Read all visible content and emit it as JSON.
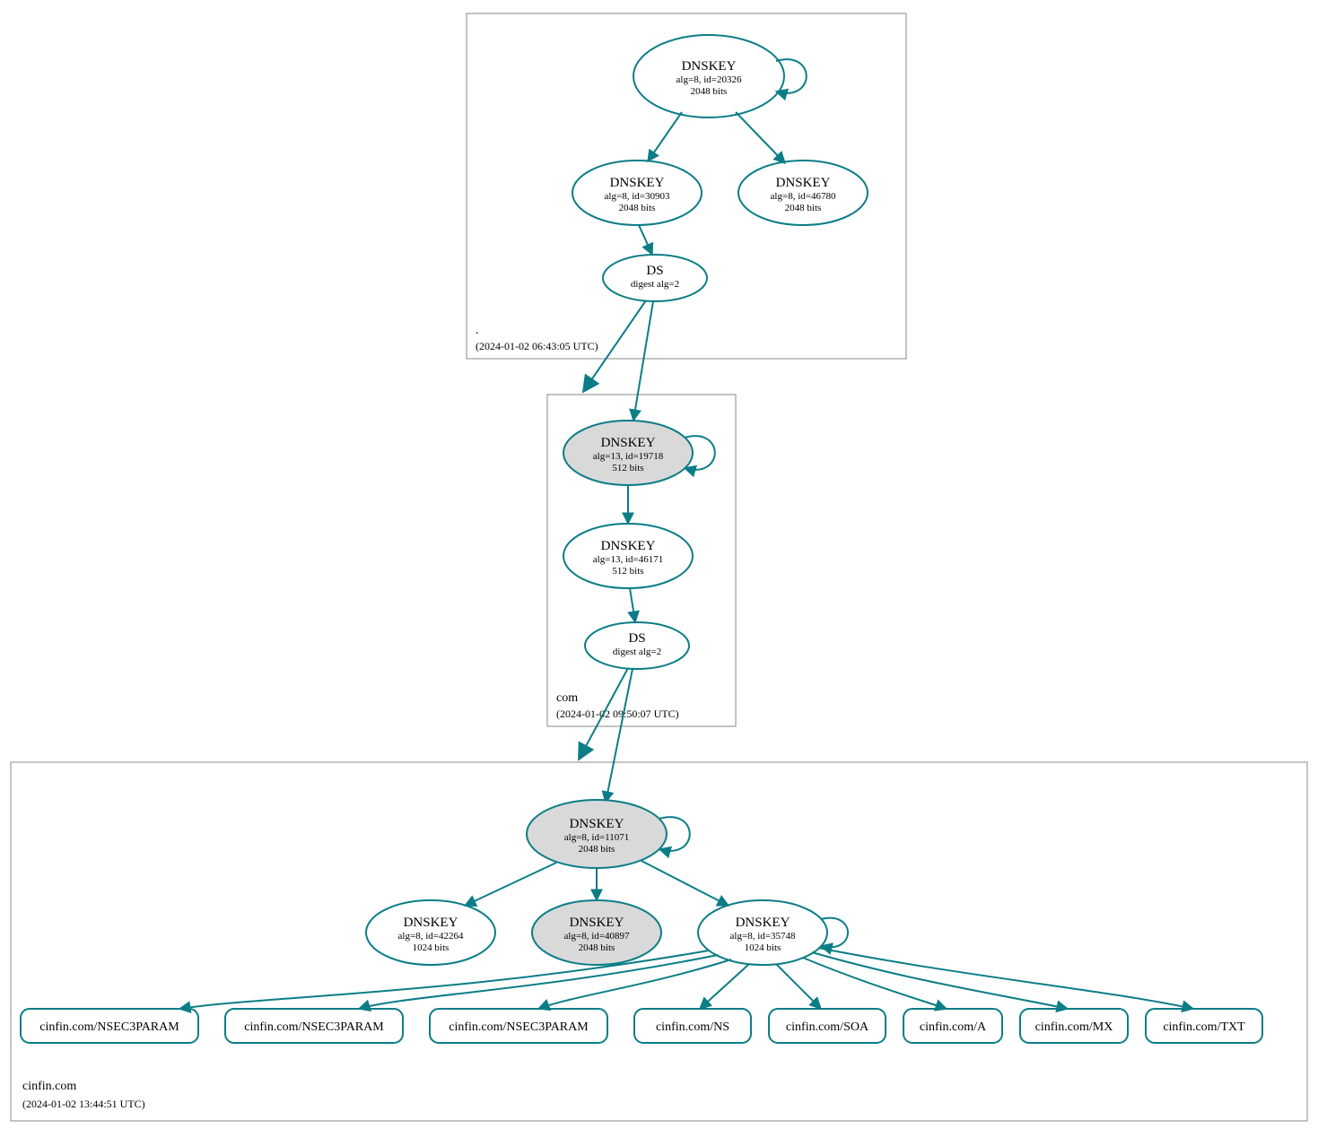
{
  "zones": {
    "root": {
      "label": ".",
      "timestamp": "(2024-01-02 06:43:05 UTC)"
    },
    "com": {
      "label": "com",
      "timestamp": "(2024-01-02 09:50:07 UTC)"
    },
    "cinfin": {
      "label": "cinfin.com",
      "timestamp": "(2024-01-02 13:44:51 UTC)"
    }
  },
  "nodes": {
    "root_ksk": {
      "title": "DNSKEY",
      "line2": "alg=8, id=20326",
      "line3": "2048 bits"
    },
    "root_zsk1": {
      "title": "DNSKEY",
      "line2": "alg=8, id=30903",
      "line3": "2048 bits"
    },
    "root_zsk2": {
      "title": "DNSKEY",
      "line2": "alg=8, id=46780",
      "line3": "2048 bits"
    },
    "root_ds": {
      "title": "DS",
      "line2": "digest alg=2"
    },
    "com_ksk": {
      "title": "DNSKEY",
      "line2": "alg=13, id=19718",
      "line3": "512 bits"
    },
    "com_zsk": {
      "title": "DNSKEY",
      "line2": "alg=13, id=46171",
      "line3": "512 bits"
    },
    "com_ds": {
      "title": "DS",
      "line2": "digest alg=2"
    },
    "cin_ksk": {
      "title": "DNSKEY",
      "line2": "alg=8, id=11071",
      "line3": "2048 bits"
    },
    "cin_k1": {
      "title": "DNSKEY",
      "line2": "alg=8, id=42264",
      "line3": "1024 bits"
    },
    "cin_k2": {
      "title": "DNSKEY",
      "line2": "alg=8, id=40897",
      "line3": "2048 bits"
    },
    "cin_k3": {
      "title": "DNSKEY",
      "line2": "alg=8, id=35748",
      "line3": "1024 bits"
    }
  },
  "rrsets": {
    "r0": "cinfin.com/NSEC3PARAM",
    "r1": "cinfin.com/NSEC3PARAM",
    "r2": "cinfin.com/NSEC3PARAM",
    "r3": "cinfin.com/NS",
    "r4": "cinfin.com/SOA",
    "r5": "cinfin.com/A",
    "r6": "cinfin.com/MX",
    "r7": "cinfin.com/TXT"
  }
}
